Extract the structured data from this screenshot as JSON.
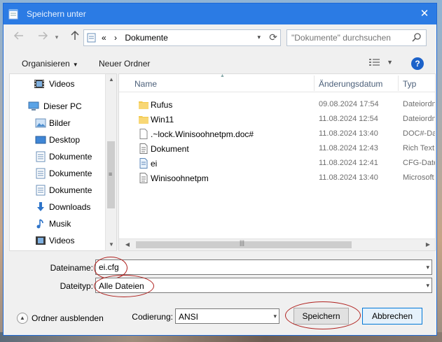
{
  "window": {
    "title": "Speichern unter",
    "close_glyph": "✕"
  },
  "navigation": {
    "back_icon": "back-arrow-icon",
    "forward_icon": "forward-arrow-icon",
    "up_icon": "up-arrow-icon"
  },
  "address": {
    "overflow": "«",
    "crumb_sep": "›",
    "current": "Dokumente"
  },
  "search": {
    "placeholder": "\"Dokumente\" durchsuchen"
  },
  "toolbar": {
    "organize": "Organisieren",
    "new_folder": "Neuer Ordner",
    "help": "?"
  },
  "sidebar": {
    "items": [
      {
        "label": "Videos",
        "icon": "videos-icon"
      },
      {
        "label": "Dieser PC",
        "icon": "computer-icon"
      },
      {
        "label": "Bilder",
        "icon": "pictures-icon"
      },
      {
        "label": "Desktop",
        "icon": "desktop-icon"
      },
      {
        "label": "Dokumente",
        "icon": "documents-icon"
      },
      {
        "label": "Dokumente",
        "icon": "documents-icon"
      },
      {
        "label": "Dokumente",
        "icon": "documents-icon"
      },
      {
        "label": "Downloads",
        "icon": "downloads-icon"
      },
      {
        "label": "Musik",
        "icon": "music-icon"
      },
      {
        "label": "Videos",
        "icon": "videos-icon"
      }
    ]
  },
  "file_list": {
    "columns": [
      "Name",
      "Änderungsdatum",
      "Typ"
    ],
    "rows": [
      {
        "name": "Rufus",
        "date": "09.08.2024 17:54",
        "type": "Dateiordn",
        "icon": "folder-icon"
      },
      {
        "name": "Win11",
        "date": "11.08.2024 12:54",
        "type": "Dateiordn",
        "icon": "folder-icon"
      },
      {
        "name": ".~lock.Winisoohnetpm.doc#",
        "date": "11.08.2024 13:40",
        "type": "DOC#-Da",
        "icon": "blank-file-icon"
      },
      {
        "name": "Dokument",
        "date": "11.08.2024 12:43",
        "type": "Rich Text",
        "icon": "wordpad-file-icon"
      },
      {
        "name": "ei",
        "date": "11.08.2024 12:41",
        "type": "CFG-Date",
        "icon": "config-file-icon"
      },
      {
        "name": "Winisoohnetpm",
        "date": "11.08.2024 13:40",
        "type": "Microsoft",
        "icon": "wordpad-file-icon"
      }
    ]
  },
  "form": {
    "filename_label": "Dateiname:",
    "filename_value": "ei.cfg",
    "filetype_label": "Dateityp:",
    "filetype_value": "Alle Dateien",
    "encoding_label": "Codierung:",
    "encoding_value": "ANSI"
  },
  "footer": {
    "hide_folders": "Ordner ausblenden",
    "save": "Speichern",
    "cancel": "Abbrechen"
  },
  "colors": {
    "titlebar": "#2b7be4",
    "annotation": "#b0221f",
    "primary_border": "#0078d7"
  }
}
